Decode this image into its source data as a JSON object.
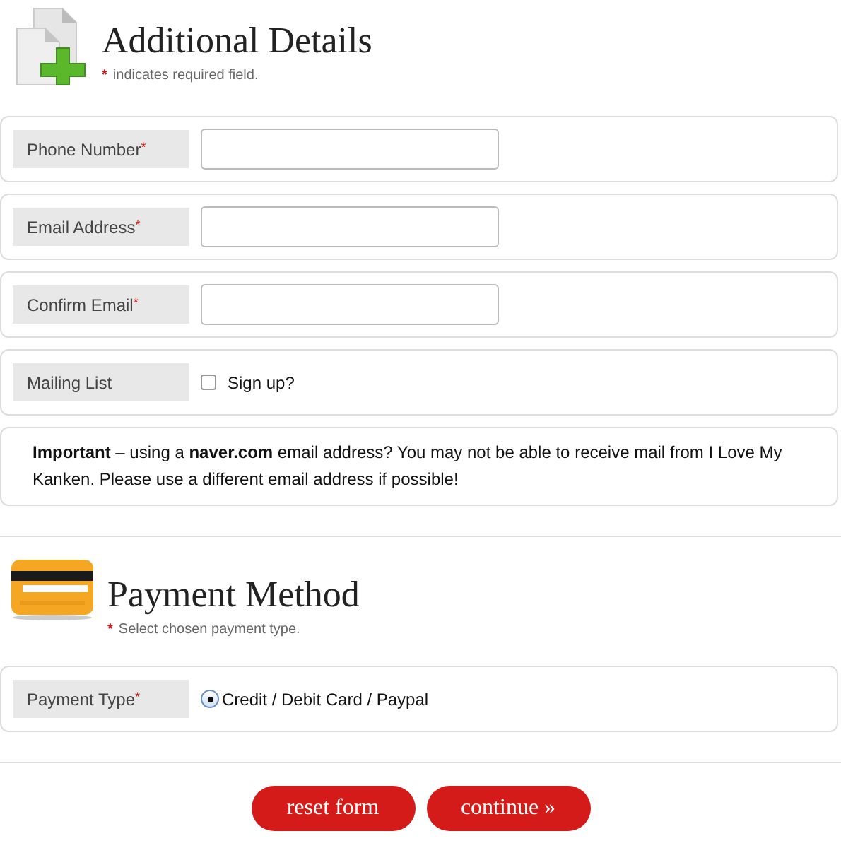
{
  "details": {
    "title": "Additional Details",
    "legend": {
      "mark": "*",
      "text": "indicates required field."
    },
    "fields": [
      {
        "kind": "text",
        "label": "Phone Number",
        "required_mark": "*"
      },
      {
        "kind": "text",
        "label": "Email Address",
        "required_mark": "*"
      },
      {
        "kind": "text",
        "label": "Confirm Email",
        "required_mark": "*"
      },
      {
        "kind": "checkbox",
        "label": "Mailing List",
        "option": "Sign up?",
        "checked": false
      }
    ],
    "notice": "**Important** – using a **naver.com** email address? You may not be able to receive mail from I Love My Kanken. Please use a different email address if possible!"
  },
  "payment": {
    "title": "Payment Method",
    "legend": {
      "mark": "*",
      "text": "Select chosen payment type."
    },
    "fields": [
      {
        "kind": "radio",
        "label": "Payment Type",
        "required_mark": "*",
        "option": "Credit / Debit Card / Paypal",
        "selected": true
      }
    ]
  },
  "buttons": [
    "reset form",
    "continue »"
  ]
}
